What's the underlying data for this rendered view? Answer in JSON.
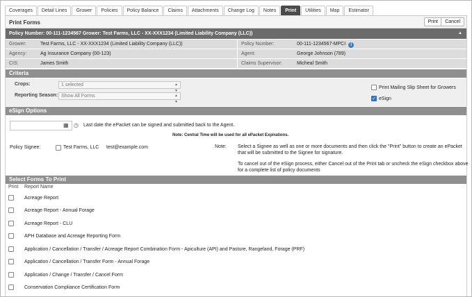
{
  "tabs": [
    {
      "label": "Coverages",
      "active": false
    },
    {
      "label": "Detail Lines",
      "active": false
    },
    {
      "label": "Grower",
      "active": false
    },
    {
      "label": "Policies",
      "active": false
    },
    {
      "label": "Policy Balance",
      "active": false
    },
    {
      "label": "Claims",
      "active": false
    },
    {
      "label": "Attachments",
      "active": false
    },
    {
      "label": "Change Log",
      "active": false
    },
    {
      "label": "Notes",
      "active": false
    },
    {
      "label": "Print",
      "active": true
    },
    {
      "label": "Utilities",
      "active": false
    },
    {
      "label": "Map",
      "active": false
    },
    {
      "label": "Estimator",
      "active": false
    }
  ],
  "print_forms": {
    "title": "Print Forms",
    "print_label": "Print",
    "cancel_label": "Cancel"
  },
  "policy_bar": {
    "text": "Policy Number: 00-111-1234567 Grower: Test Farms, LLC - XX-XXX1234 (Limited Liability Company (LLC))",
    "caret": "▲"
  },
  "info": {
    "grower_label": "Grower:",
    "grower_value": "Test Farms, LLC - XX-XXX1234 (Limited Liability Company (LLC))",
    "policy_number_label": "Policy Number:",
    "policy_number_value": "00-111-1234567-MPCI",
    "agency_label": "Agency:",
    "agency_value": "Ag Insurance Company (00-123)",
    "agent_label": "Agent:",
    "agent_value": "George Johnson (789)",
    "cis_label": "CIS:",
    "cis_value": "James Smith",
    "claims_supervisor_label": "Claims Supervisor:",
    "claims_supervisor_value": "Micheal Smith"
  },
  "criteria": {
    "title": "Criteria",
    "crops_label": "Crops:",
    "crops_value": "1 selected",
    "season_label": "Reporting Season:",
    "season_value": "Show All Forms",
    "mailing_slip_label": "Print Mailing Slip Sheet for Growers",
    "mailing_slip_checked": false,
    "esign_label": "eSign",
    "esign_checked": true
  },
  "esign": {
    "title": "eSign Options",
    "date_value": "",
    "date_help": "Last date the ePacket can be signed and submitted back to the Agent.",
    "central_time_note": "Note: Central Time will be used for all ePacket Expirations.",
    "policy_signee_label": "Policy Signee:",
    "signee_name": "Test Farms, LLC",
    "signee_email": "test@example.com",
    "note_label": "Note:",
    "note_line1": "Select a Signee as well as one or more documents and then click the \"Print\" button to create an ePacket",
    "note_line2": "that will be submitted to the Signee for signature.",
    "note_line3": "To cancel out of the eSign process, either Cancel out of the Print tab or uncheck the eSign checkbox above",
    "note_line4": "for a complete list of policy documents"
  },
  "forms": {
    "title": "Select Forms To Print",
    "col_print": "Print",
    "col_report": "Report Name",
    "rows": [
      "Acreage Report",
      "Acreage Report - Annual Forage",
      "Acreage Report - CLU",
      "APH Database and Acreage Reporting Form",
      "Application / Cancellation / Transfer / Acreage Report Combination Form - Apiculture (API) and Pasture, Rangeland, Forage (PRF)",
      "Application / Cancellation / Transfer Form - Annual Forage",
      "Application / Change / Transfer / Cancel Form",
      "Conservation Compliance Certification Form"
    ]
  }
}
